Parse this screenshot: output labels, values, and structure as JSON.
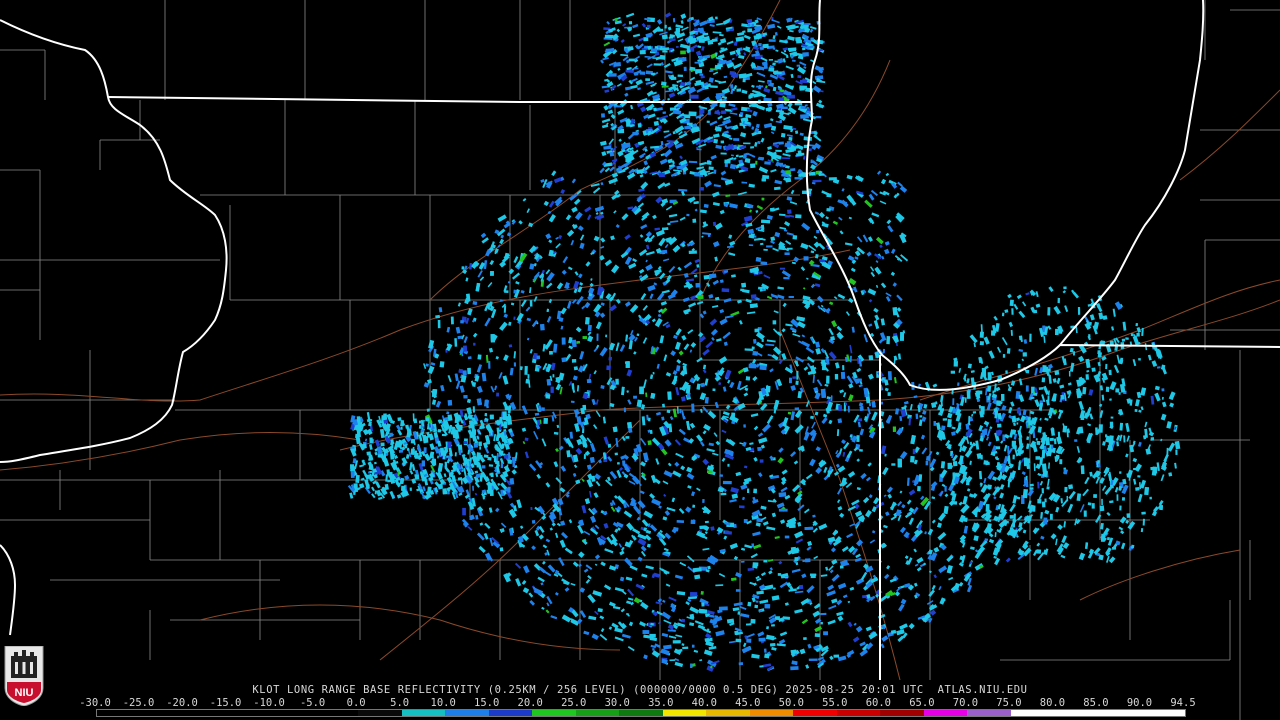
{
  "product": {
    "caption": "KLOT LONG RANGE BASE REFLECTIVITY (0.25KM / 256 LEVEL) (000000/0000 0.5 DEG) 2025-08-25 20:01 UTC  ATLAS.NIU.EDU"
  },
  "scale": {
    "labels": [
      "-30.0",
      "-25.0",
      "-20.0",
      "-15.0",
      "-10.0",
      "-5.0",
      "0.0",
      "5.0",
      "10.0",
      "15.0",
      "20.0",
      "25.0",
      "30.0",
      "35.0",
      "40.0",
      "45.0",
      "50.0",
      "55.0",
      "60.0",
      "65.0",
      "70.0",
      "75.0",
      "80.0",
      "85.0",
      "90.0",
      "94.5"
    ],
    "colors": [
      "#000000",
      "#000000",
      "#000000",
      "#000000",
      "#000000",
      "#000000",
      "#0a0a0a",
      "#15bfc2",
      "#1e7fe8",
      "#1c3cc8",
      "#21c721",
      "#17a017",
      "#0f7a0f",
      "#f2e600",
      "#e6b800",
      "#f08c00",
      "#f00000",
      "#c80000",
      "#a00000",
      "#e600e6",
      "#9a5fc8",
      "#ffffff",
      "#ffffff",
      "#ffffff",
      "#ffffff"
    ]
  },
  "logo": {
    "text": "NIU"
  },
  "icons": {
    "logo": "niu-logo-icon"
  },
  "theme": {
    "background": "#000000",
    "state_border": "#ffffff",
    "county_line": "#8a8a8a",
    "road": "#8b4a2a",
    "echo_light": "#1ec8e6",
    "echo_mid": "#1e82ec",
    "echo_strong": "#1f3fd0",
    "echo_green": "#22c422"
  }
}
